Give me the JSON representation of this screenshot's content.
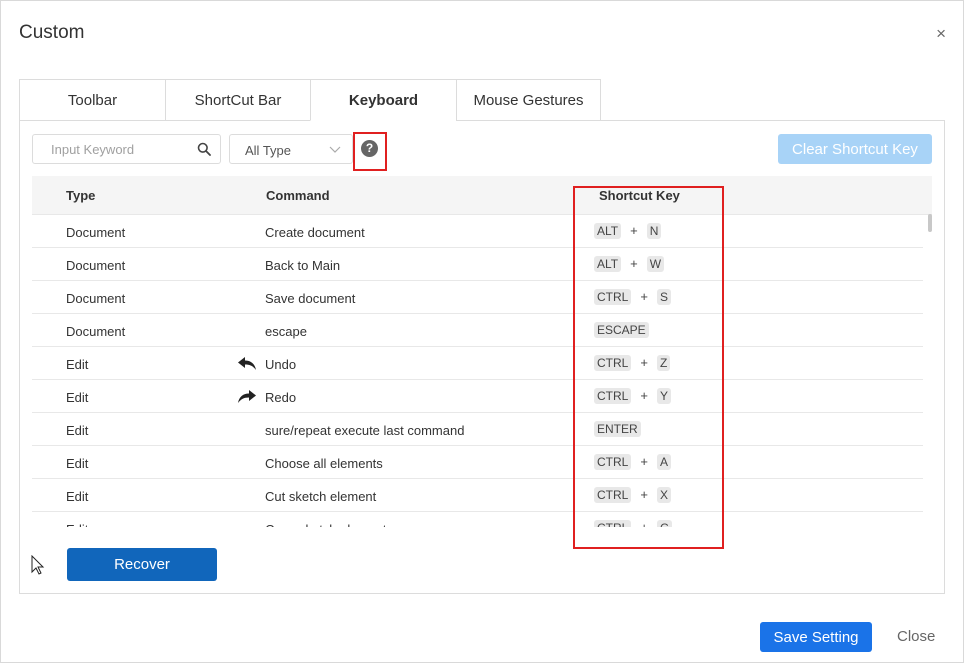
{
  "dialog": {
    "title": "Custom",
    "close_glyph": "×"
  },
  "tabs": [
    {
      "label": "Toolbar",
      "active": false
    },
    {
      "label": "ShortCut Bar",
      "active": false
    },
    {
      "label": "Keyboard",
      "active": true
    },
    {
      "label": "Mouse Gestures",
      "active": false
    }
  ],
  "filters": {
    "search_placeholder": "Input Keyword",
    "search_value": "",
    "type_selected": "All Type",
    "help_glyph": "?"
  },
  "clear_button_label": "Clear Shortcut Key",
  "table": {
    "headers": {
      "type": "Type",
      "command": "Command",
      "shortcut": "Shortcut Key"
    },
    "rows": [
      {
        "type": "Document",
        "command": "Create document",
        "icon": "",
        "keys": [
          "ALT",
          "N"
        ]
      },
      {
        "type": "Document",
        "command": "Back to Main",
        "icon": "",
        "keys": [
          "ALT",
          "W"
        ]
      },
      {
        "type": "Document",
        "command": "Save document",
        "icon": "",
        "keys": [
          "CTRL",
          "S"
        ]
      },
      {
        "type": "Document",
        "command": "escape",
        "icon": "",
        "keys": [
          "ESCAPE"
        ]
      },
      {
        "type": "Edit",
        "command": "Undo",
        "icon": "undo-icon",
        "keys": [
          "CTRL",
          "Z"
        ]
      },
      {
        "type": "Edit",
        "command": "Redo",
        "icon": "redo-icon",
        "keys": [
          "CTRL",
          "Y"
        ]
      },
      {
        "type": "Edit",
        "command": "sure/repeat execute last command",
        "icon": "",
        "keys": [
          "ENTER"
        ]
      },
      {
        "type": "Edit",
        "command": "Choose all elements",
        "icon": "",
        "keys": [
          "CTRL",
          "A"
        ]
      },
      {
        "type": "Edit",
        "command": "Cut sketch element",
        "icon": "",
        "keys": [
          "CTRL",
          "X"
        ]
      },
      {
        "type": "Edit",
        "command": "Copy sketch element",
        "icon": "",
        "keys": [
          "CTRL",
          "C"
        ]
      }
    ],
    "plus_glyph": "+"
  },
  "recover_label": "Recover",
  "footer": {
    "save_label": "Save Setting",
    "close_label": "Close"
  },
  "colors": {
    "primary": "#1a73e8",
    "recover": "#1166bb",
    "clear_disabled": "#a8d3f7",
    "highlight_box": "#e02020"
  }
}
